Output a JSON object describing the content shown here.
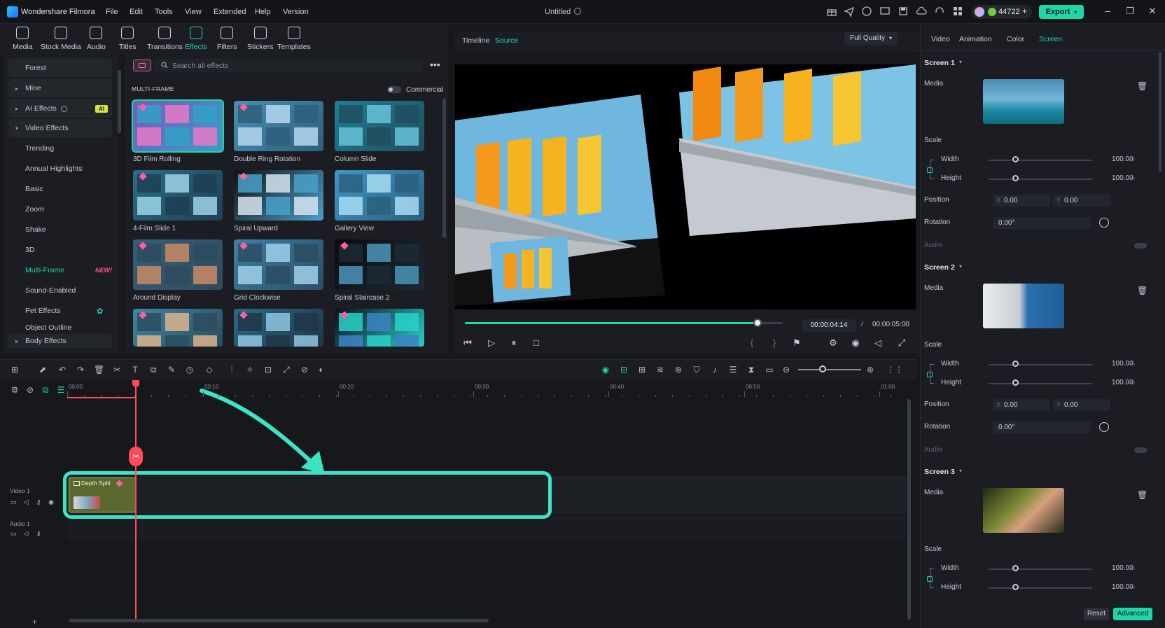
{
  "titlebar": {
    "app_name": "Wondershare Filmora",
    "menu": [
      "File",
      "Edit",
      "Tools",
      "View",
      "Extended",
      "Help",
      "Version"
    ],
    "document_title": "Untitled",
    "credits": "44722",
    "export_label": "Export"
  },
  "media_toolbar": {
    "items": [
      {
        "label": "Media",
        "icon": "media-icon"
      },
      {
        "label": "Stock Media",
        "icon": "stock-media-icon"
      },
      {
        "label": "Audio",
        "icon": "audio-icon"
      },
      {
        "label": "Titles",
        "icon": "titles-icon"
      },
      {
        "label": "Transitions",
        "icon": "transitions-icon"
      },
      {
        "label": "Effects",
        "icon": "effects-icon",
        "active": true
      },
      {
        "label": "Filters",
        "icon": "filters-icon"
      },
      {
        "label": "Stickers",
        "icon": "stickers-icon"
      },
      {
        "label": "Templates",
        "icon": "templates-icon"
      }
    ]
  },
  "effects_sidebar": {
    "items": [
      {
        "label": "Forest",
        "kind": "cat"
      },
      {
        "label": "Mine",
        "kind": "cat"
      },
      {
        "label": "AI Effects",
        "kind": "cat",
        "badge": "AI"
      },
      {
        "label": "Video Effects",
        "kind": "cat",
        "expanded": true
      },
      {
        "label": "Trending",
        "kind": "sub"
      },
      {
        "label": "Annual Highlights",
        "kind": "sub"
      },
      {
        "label": "Basic",
        "kind": "sub"
      },
      {
        "label": "Zoom",
        "kind": "sub"
      },
      {
        "label": "Shake",
        "kind": "sub"
      },
      {
        "label": "3D",
        "kind": "sub"
      },
      {
        "label": "Multi-Frame",
        "kind": "sub",
        "active": true,
        "badge": "NEW!"
      },
      {
        "label": "Sound-Enabled",
        "kind": "sub"
      },
      {
        "label": "Pet Effects",
        "kind": "sub"
      },
      {
        "label": "Object Outline",
        "kind": "sub"
      },
      {
        "label": "Body Effects",
        "kind": "cat"
      }
    ]
  },
  "effects_panel": {
    "search_placeholder": "Search all effects",
    "section_title": "MULTI-FRAME",
    "commercial_label": "Commercial",
    "effects": [
      "3D Film Rolling",
      "Double Ring Rotation",
      "Column Slide",
      "4-Film Slide 1",
      "Spiral Upward",
      "Gallery View",
      "Around Display",
      "Grid Clockwise",
      "Spiral Staircase 2",
      "",
      "",
      ""
    ]
  },
  "preview": {
    "tab_timeline": "Timeline",
    "tab_source": "Source",
    "quality": "Full Quality",
    "progress": 0.92,
    "current_time": "00:00:04:14",
    "separator": "/",
    "total_time": "00:00:05:00"
  },
  "properties": {
    "tabs": [
      "Video",
      "Animation",
      "Color",
      "Screen"
    ],
    "active_tab": "Screen",
    "screens": [
      {
        "title": "Screen 1",
        "media": "Media",
        "scale": "Scale",
        "width_label": "Width",
        "width": "100.00",
        "height_label": "Height",
        "height": "100.00",
        "unit": "%",
        "position": "Position",
        "x": "0.00",
        "y": "0.00",
        "rotation": "Rotation",
        "rotation_val": "0.00°",
        "audio": "Audio"
      },
      {
        "title": "Screen 2",
        "media": "Media",
        "scale": "Scale",
        "width_label": "Width",
        "width": "100.00",
        "height_label": "Height",
        "height": "100.00",
        "unit": "%",
        "position": "Position",
        "x": "0.00",
        "y": "0.00",
        "rotation": "Rotation",
        "rotation_val": "0.00°",
        "audio": "Audio"
      },
      {
        "title": "Screen 3",
        "media": "Media",
        "scale": "Scale",
        "width_label": "Width",
        "width": "100.00",
        "height_label": "Height",
        "height": "100.00",
        "unit": "%"
      }
    ],
    "reset_label": "Reset",
    "advanced_label": "Advanced"
  },
  "timeline": {
    "ruler": [
      "00:00",
      "00:10",
      "00:20",
      "00:30",
      "00:40",
      "00:50",
      "01:00"
    ],
    "video_track_label": "Video 1",
    "audio_track_label": "Audio 1",
    "clip_label": "Depth Split",
    "add_track": "+"
  },
  "colors": {
    "accent": "#1fd6a8",
    "highlight": "#3ee2c4",
    "playhead": "#ff4a5a",
    "clip": "#5a6a2f"
  }
}
